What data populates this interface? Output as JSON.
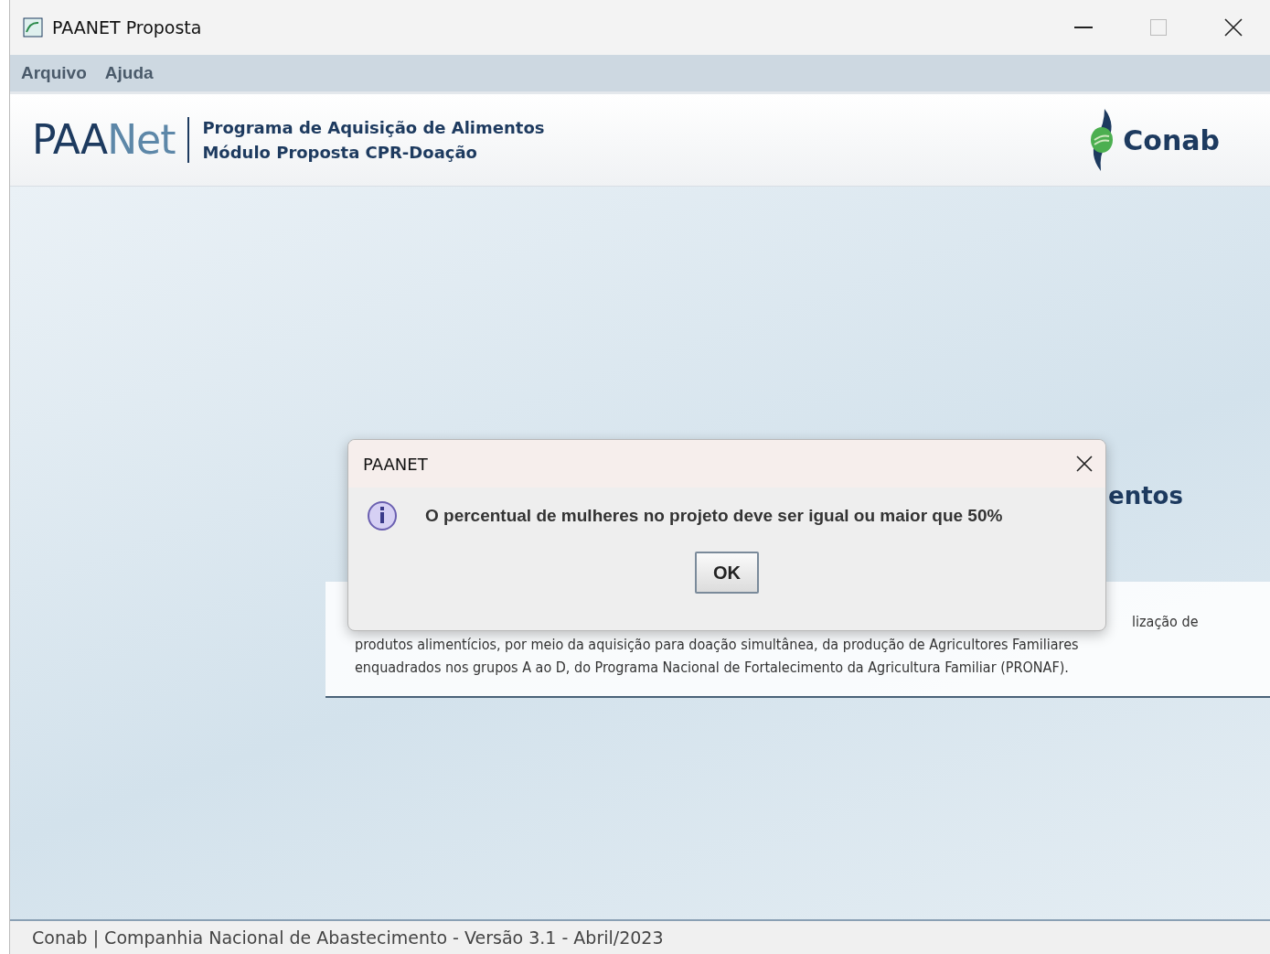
{
  "window": {
    "title": "PAANET Proposta"
  },
  "menu": [
    "Arquivo",
    "Ajuda"
  ],
  "header": {
    "logo_dark": "PAA",
    "logo_light": "Net",
    "line_1": "Programa de Aquisição de Alimentos",
    "line_2": "Módulo Proposta CPR-Doação",
    "partner": "Conab"
  },
  "background_panel": {
    "heading_visible": "entos",
    "lines": [
      "lização de",
      "produtos alimentícios, por meio da aquisição para doação simultânea, da produção de Agricultores Familiares",
      "enquadrados nos grupos A ao D, do Programa Nacional de Fortalecimento da Agricultura Familiar (PRONAF)."
    ]
  },
  "dialog": {
    "title": "PAANET",
    "message": "O percentual de mulheres no projeto deve ser igual ou maior que 50%",
    "button": "OK"
  },
  "status_bar": "Conab | Companhia Nacional de Abastecimento - Versão 3.1 - Abril/2023"
}
